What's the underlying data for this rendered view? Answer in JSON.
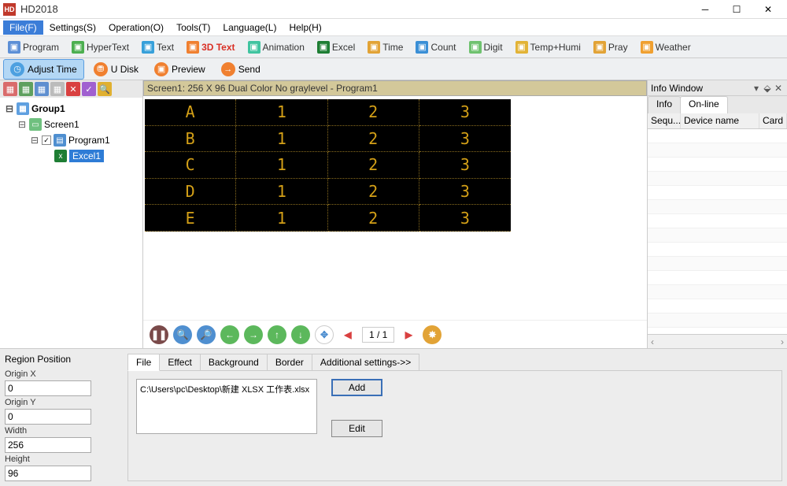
{
  "app": {
    "title": "HD2018",
    "icon_text": "HD"
  },
  "menu": [
    "File(F)",
    "Settings(S)",
    "Operation(O)",
    "Tools(T)",
    "Language(L)",
    "Help(H)"
  ],
  "toolbar1": [
    {
      "label": "Program",
      "color": "#5c8fd6",
      "name": "program"
    },
    {
      "label": "HyperText",
      "color": "#4caf50",
      "name": "hypertext"
    },
    {
      "label": "Text",
      "color": "#37a0da",
      "name": "text"
    },
    {
      "label": "3D Text",
      "color": "#f08030",
      "name": "3dtext",
      "red": true
    },
    {
      "label": "Animation",
      "color": "#40c4a0",
      "name": "animation"
    },
    {
      "label": "Excel",
      "color": "#1e7e34",
      "name": "excel"
    },
    {
      "label": "Time",
      "color": "#e2a336",
      "name": "time"
    },
    {
      "label": "Count",
      "color": "#3a8fd6",
      "name": "count"
    },
    {
      "label": "Digit",
      "color": "#6fc26f",
      "name": "digit"
    },
    {
      "label": "Temp+Humi",
      "color": "#e2b336",
      "name": "temphumi"
    },
    {
      "label": "Pray",
      "color": "#e2a336",
      "name": "pray"
    },
    {
      "label": "Weather",
      "color": "#f0a030",
      "name": "weather"
    }
  ],
  "toolbar2": [
    {
      "label": "Adjust Time",
      "color": "#4da0e0",
      "icon": "◷",
      "name": "adjust-time",
      "cls": "adjust"
    },
    {
      "label": "U Disk",
      "color": "#f08030",
      "icon": "⛃",
      "name": "udisk"
    },
    {
      "label": "Preview",
      "color": "#f08030",
      "icon": "▣",
      "name": "preview"
    },
    {
      "label": "Send",
      "color": "#f08030",
      "icon": "→",
      "name": "send"
    }
  ],
  "iconrow_colors": [
    "#d96b6b",
    "#5fa05f",
    "#5f8fd0",
    "#bbbbbb",
    "#d94040",
    "#a060d0",
    "#e0b030"
  ],
  "tree": {
    "root": "Group1",
    "screen": "Screen1",
    "program": "Program1",
    "item": "Excel1"
  },
  "screen_text": "Screen1: 256 X 96  Dual Color No graylevel - Program1",
  "chart_data": {
    "type": "table",
    "rows": [
      [
        "A",
        "1",
        "2",
        "3"
      ],
      [
        "B",
        "1",
        "2",
        "3"
      ],
      [
        "C",
        "1",
        "2",
        "3"
      ],
      [
        "D",
        "1",
        "2",
        "3"
      ],
      [
        "E",
        "1",
        "2",
        "3"
      ]
    ]
  },
  "nav": {
    "page": "1 / 1"
  },
  "info": {
    "title": "Info Window",
    "tabs": [
      "Info",
      "On-line"
    ],
    "cols": [
      "Sequ...",
      "Device name",
      "Card"
    ]
  },
  "region": {
    "title": "Region Position",
    "originx_lbl": "Origin X",
    "originx": "0",
    "originy_lbl": "Origin Y",
    "originy": "0",
    "width_lbl": "Width",
    "width": "256",
    "height_lbl": "Height",
    "height": "96"
  },
  "ftabs": [
    "File",
    "Effect",
    "Background",
    "Border",
    "Additional settings->>"
  ],
  "file_entry": "C:\\Users\\pc\\Desktop\\新建 XLSX 工作表.xlsx",
  "btn_add": "Add",
  "btn_edit": "Edit"
}
